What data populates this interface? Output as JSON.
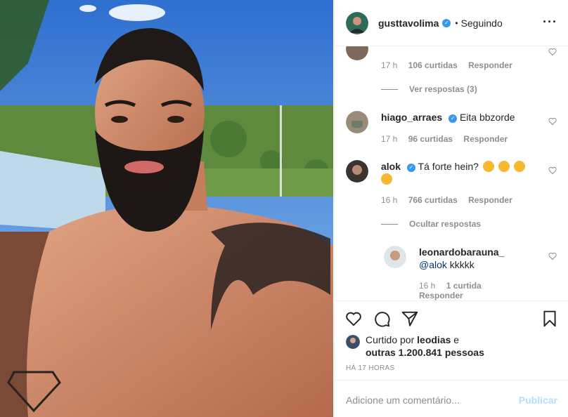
{
  "post": {
    "image_icon": "selfie-photo"
  },
  "header": {
    "username": "gusttavolima",
    "verified_icon": "verified-badge-icon",
    "separator": "•",
    "follow_status": "Seguindo",
    "more_icon": "more-options-icon"
  },
  "comments": {
    "top_partial": {
      "time": "17 h",
      "likes": "106 curtidas",
      "reply": "Responder",
      "thread_toggle": "Ver respostas (3)"
    },
    "items": [
      {
        "username": "hiago_arraes",
        "verified": true,
        "text": "Eita bbzorde",
        "time": "17 h",
        "likes": "96 curtidas",
        "reply": "Responder"
      },
      {
        "username": "alok",
        "verified": true,
        "text": "Tá forte hein?",
        "emojis": [
          "flexed-biceps",
          "clapping-hands",
          "clapping-hands",
          "clapping-hands"
        ],
        "time": "16 h",
        "likes": "766 curtidas",
        "reply": "Responder",
        "thread_toggle": "Ocultar respostas"
      }
    ],
    "reply": {
      "username": "leonardobarauna_",
      "mention": "@alok",
      "text": "kkkkk",
      "time": "16 h",
      "likes": "1 curtida",
      "reply": "Responder"
    }
  },
  "actions": {
    "like_icon": "heart-icon",
    "comment_icon": "comment-icon",
    "share_icon": "share-icon",
    "save_icon": "bookmark-icon"
  },
  "likes_summary": {
    "prefix": "Curtido por",
    "user": "leodias",
    "connector": "e",
    "others": "outras 1.200.841 pessoas"
  },
  "timestamp": "HÁ 17 HORAS",
  "add_comment": {
    "placeholder": "Adicione um comentário...",
    "publish": "Publicar"
  },
  "colors": {
    "accent": "#3897f0",
    "publish_disabled": "#b2dffc",
    "meta_text": "#8e8e8e",
    "mention": "#00376b"
  }
}
